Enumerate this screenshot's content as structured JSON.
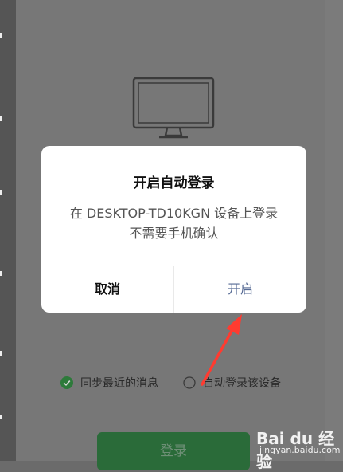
{
  "dialog": {
    "title": "开启自动登录",
    "message_line1": "在 DESKTOP-TD10KGN 设备上登录",
    "message_line2": "不需要手机确认",
    "cancel_label": "取消",
    "confirm_label": "开启"
  },
  "options": {
    "sync_label": "同步最近的消息",
    "sync_checked": true,
    "auto_login_label": "自动登录该设备",
    "auto_login_checked": false
  },
  "login_button_label": "登录",
  "watermark": {
    "brand": "Bai du 经验",
    "url": "jingyan.baidu.com"
  },
  "colors": {
    "overlay": "#6b6b6b",
    "check_green": "#2d7a3a",
    "login_button": "#2a6b39",
    "confirm_text": "#576b95",
    "arrow": "#ff3b30"
  },
  "icons": [
    "monitor-icon",
    "check-circle-icon",
    "empty-circle-icon",
    "red-arrow",
    "baidu-paw-icon"
  ]
}
